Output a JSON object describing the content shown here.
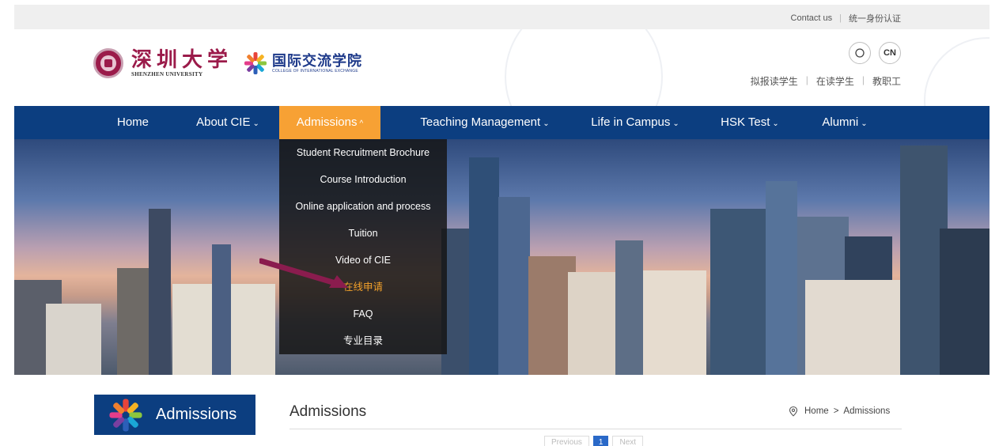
{
  "topbar": {
    "contact_label": "Contact us",
    "sso_label": "统一身份认证",
    "separator": "|"
  },
  "header": {
    "szu_cn": "深圳大学",
    "szu_en": "SHENZHEN UNIVERSITY",
    "cie_cn": "国际交流学院",
    "cie_en": "COLLEGE OF INTERNATIONAL EXCHANGE",
    "lang_label": "CN",
    "user_links": [
      "拟报读学生",
      "在读学生",
      "教职工"
    ]
  },
  "nav": {
    "home": "Home",
    "about": "About CIE",
    "admissions": "Admissions",
    "teaching": "Teaching Management",
    "life": "Life in Campus",
    "hsk": "HSK Test",
    "alumni": "Alumni",
    "caret_down": "⌄",
    "caret_up": "^"
  },
  "dropdown": {
    "items": [
      "Student Recruitment Brochure",
      "Course Introduction",
      "Online application and process",
      "Tuition",
      "Video of CIE",
      "在线申请",
      "FAQ",
      "专业目录"
    ],
    "highlight_color": "#f3a12a"
  },
  "sidebar": {
    "title": "Admissions"
  },
  "main": {
    "title": "Admissions",
    "breadcrumb_home": "Home",
    "breadcrumb_sep": ">",
    "breadcrumb_current": "Admissions",
    "pager_prev": "Previous",
    "pager_page": "1",
    "pager_next": "Next"
  },
  "colors": {
    "nav_bg": "#0c3e80",
    "nav_active": "#f7a134",
    "brand": "#9b1b4a",
    "arrow": "#8a1c4e"
  }
}
